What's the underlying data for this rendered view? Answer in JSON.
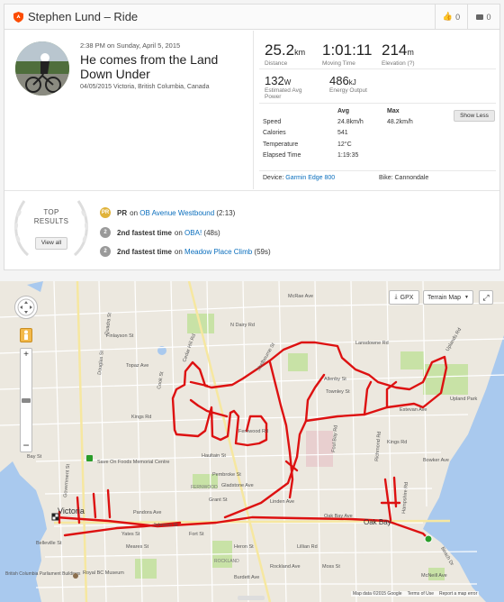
{
  "header": {
    "title": "Stephen Lund – Ride",
    "kudos_count": "0",
    "comment_count": "0"
  },
  "activity": {
    "date_line": "2:38 PM on Sunday, April 5, 2015",
    "name": "He comes from the Land Down Under",
    "location": "04/05/2015 Victoria, British Columbia, Canada"
  },
  "stats": {
    "distance": {
      "value": "25.2",
      "unit": "km",
      "label": "Distance"
    },
    "moving_time": {
      "value": "1:01:11",
      "label": "Moving Time"
    },
    "elevation": {
      "value": "214",
      "unit": "m",
      "label": "Elevation (?)"
    },
    "power": {
      "value": "132",
      "unit": "W",
      "label": "Estimated Avg Power"
    },
    "energy": {
      "value": "486",
      "unit": "kJ",
      "label": "Energy Output"
    }
  },
  "details": {
    "col_avg": "Avg",
    "col_max": "Max",
    "rows": [
      {
        "label": "Speed",
        "avg": "24.8km/h",
        "max": "48.2km/h"
      },
      {
        "label": "Calories",
        "avg": "541",
        "max": ""
      },
      {
        "label": "Temperature",
        "avg": "12°C",
        "max": ""
      },
      {
        "label": "Elapsed Time",
        "avg": "1:19:35",
        "max": ""
      }
    ],
    "show_less": "Show Less",
    "device_label": "Device:",
    "device": "Garmin Edge 800",
    "bike": "Bike: Cannondale"
  },
  "top_results": {
    "title1": "TOP",
    "title2": "RESULTS",
    "view_all": "View all",
    "items": [
      {
        "badge": "PR",
        "prefix": "PR",
        "mid": "on",
        "segment": "OB Avenue Westbound",
        "time": "(2:13)",
        "color": "#e0b33a"
      },
      {
        "badge": "2",
        "prefix": "2nd fastest time",
        "mid": "on",
        "segment": "OBA!",
        "time": "(48s)",
        "color": "#9a9a9a"
      },
      {
        "badge": "2",
        "prefix": "2nd fastest time",
        "mid": "on",
        "segment": "Meadow Place Climb",
        "time": "(59s)",
        "color": "#9a9a9a"
      }
    ]
  },
  "map": {
    "gpx_button": "GPX",
    "map_type": "Terrain Map",
    "attribution": "Map data ©2015 Google",
    "terms": "Terms of Use",
    "report": "Report a map error",
    "labels": [
      "Finlayson St",
      "Topaz Ave",
      "Kings Rd",
      "Bay St",
      "Fernwood Rd",
      "Haultain St",
      "Pembroke St",
      "Gladstone Ave",
      "Grant St",
      "Pandora Ave",
      "Johnson St",
      "Yates St",
      "Fort St",
      "Oak Bay Ave",
      "Cook St",
      "Quadra St",
      "Victoria",
      "Save On Foods Memorial Centre",
      "FERNWOOD",
      "ROCKLAND",
      "Oak Bay",
      "Upland Park",
      "Lansdowne Rd",
      "Allenby St",
      "Townley St",
      "Estevan Ave",
      "Bowker Ave",
      "Foul Bay Rd",
      "Richmond Rd",
      "Belleville St",
      "Royal BC Museum",
      "British Columbia Parliament Buildings",
      "Heron St",
      "Meares St",
      "Rockland Ave",
      "Moss St",
      "Linden Ave",
      "Lillian Rd",
      "Hampshire Rd",
      "N Dairy Rd",
      "McRae Ave",
      "Shelbourne St",
      "Beach Dr",
      "Burdett Ave",
      "Government St",
      "Douglas St",
      "Cedar Hill Rd",
      "Uplands Rd",
      "McNeill Ave",
      "Kings Rd"
    ]
  },
  "colors": {
    "accent": "#fc4c02",
    "link": "#0a6ebd",
    "route": "#dd1111",
    "water": "#a9c9ee",
    "park": "#c8e2a6",
    "map_bg": "#ece8df"
  }
}
